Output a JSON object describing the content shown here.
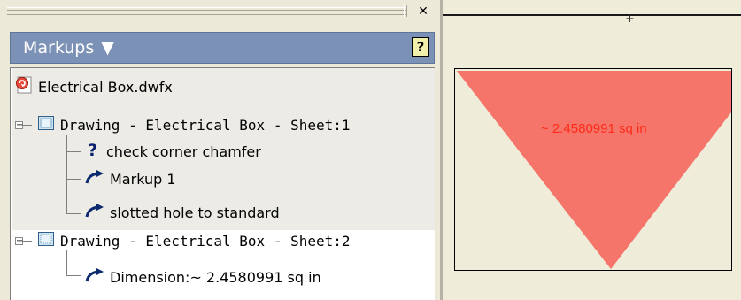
{
  "palette": {
    "title": "Markups",
    "title_arrow": "▼",
    "close_glyph": "✕",
    "help_glyph": "?"
  },
  "tree": {
    "root": {
      "label": "Electrical Box.dwfx",
      "icon": "dwfx-file-icon"
    },
    "sheets": [
      {
        "label": "Drawing - Electrical Box - Sheet:1",
        "expander": "−",
        "icon": "sheet-icon",
        "markups": [
          {
            "label": "check corner chamfer",
            "icon": "question-icon"
          },
          {
            "label": "Markup 1",
            "icon": "markup-arrow-icon"
          },
          {
            "label": "slotted hole to standard",
            "icon": "markup-arrow-icon"
          }
        ]
      },
      {
        "label": "Drawing - Electrical Box - Sheet:2",
        "expander": "−",
        "icon": "sheet-icon",
        "markups": [
          {
            "label": "Dimension:~ 2.4580991 sq in",
            "icon": "markup-arrow-icon"
          }
        ]
      }
    ]
  },
  "view": {
    "ruler_mark": "+",
    "area_label": "~ 2.4580991 sq in",
    "triangle_color": "#f5756a",
    "label_color": "#ff2a17"
  }
}
